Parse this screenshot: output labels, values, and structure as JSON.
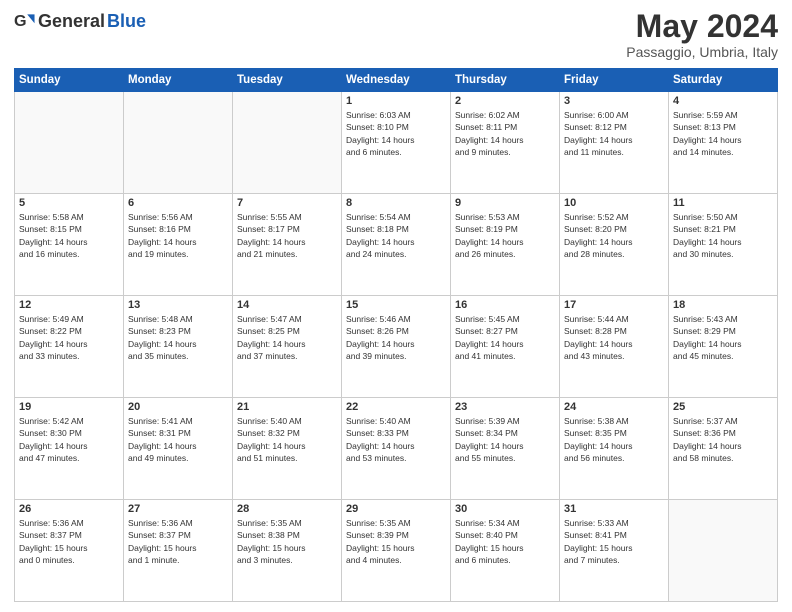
{
  "header": {
    "logo_general": "General",
    "logo_blue": "Blue",
    "title": "May 2024",
    "location": "Passaggio, Umbria, Italy"
  },
  "days_of_week": [
    "Sunday",
    "Monday",
    "Tuesday",
    "Wednesday",
    "Thursday",
    "Friday",
    "Saturday"
  ],
  "weeks": [
    [
      {
        "day": "",
        "info": ""
      },
      {
        "day": "",
        "info": ""
      },
      {
        "day": "",
        "info": ""
      },
      {
        "day": "1",
        "info": "Sunrise: 6:03 AM\nSunset: 8:10 PM\nDaylight: 14 hours\nand 6 minutes."
      },
      {
        "day": "2",
        "info": "Sunrise: 6:02 AM\nSunset: 8:11 PM\nDaylight: 14 hours\nand 9 minutes."
      },
      {
        "day": "3",
        "info": "Sunrise: 6:00 AM\nSunset: 8:12 PM\nDaylight: 14 hours\nand 11 minutes."
      },
      {
        "day": "4",
        "info": "Sunrise: 5:59 AM\nSunset: 8:13 PM\nDaylight: 14 hours\nand 14 minutes."
      }
    ],
    [
      {
        "day": "5",
        "info": "Sunrise: 5:58 AM\nSunset: 8:15 PM\nDaylight: 14 hours\nand 16 minutes."
      },
      {
        "day": "6",
        "info": "Sunrise: 5:56 AM\nSunset: 8:16 PM\nDaylight: 14 hours\nand 19 minutes."
      },
      {
        "day": "7",
        "info": "Sunrise: 5:55 AM\nSunset: 8:17 PM\nDaylight: 14 hours\nand 21 minutes."
      },
      {
        "day": "8",
        "info": "Sunrise: 5:54 AM\nSunset: 8:18 PM\nDaylight: 14 hours\nand 24 minutes."
      },
      {
        "day": "9",
        "info": "Sunrise: 5:53 AM\nSunset: 8:19 PM\nDaylight: 14 hours\nand 26 minutes."
      },
      {
        "day": "10",
        "info": "Sunrise: 5:52 AM\nSunset: 8:20 PM\nDaylight: 14 hours\nand 28 minutes."
      },
      {
        "day": "11",
        "info": "Sunrise: 5:50 AM\nSunset: 8:21 PM\nDaylight: 14 hours\nand 30 minutes."
      }
    ],
    [
      {
        "day": "12",
        "info": "Sunrise: 5:49 AM\nSunset: 8:22 PM\nDaylight: 14 hours\nand 33 minutes."
      },
      {
        "day": "13",
        "info": "Sunrise: 5:48 AM\nSunset: 8:23 PM\nDaylight: 14 hours\nand 35 minutes."
      },
      {
        "day": "14",
        "info": "Sunrise: 5:47 AM\nSunset: 8:25 PM\nDaylight: 14 hours\nand 37 minutes."
      },
      {
        "day": "15",
        "info": "Sunrise: 5:46 AM\nSunset: 8:26 PM\nDaylight: 14 hours\nand 39 minutes."
      },
      {
        "day": "16",
        "info": "Sunrise: 5:45 AM\nSunset: 8:27 PM\nDaylight: 14 hours\nand 41 minutes."
      },
      {
        "day": "17",
        "info": "Sunrise: 5:44 AM\nSunset: 8:28 PM\nDaylight: 14 hours\nand 43 minutes."
      },
      {
        "day": "18",
        "info": "Sunrise: 5:43 AM\nSunset: 8:29 PM\nDaylight: 14 hours\nand 45 minutes."
      }
    ],
    [
      {
        "day": "19",
        "info": "Sunrise: 5:42 AM\nSunset: 8:30 PM\nDaylight: 14 hours\nand 47 minutes."
      },
      {
        "day": "20",
        "info": "Sunrise: 5:41 AM\nSunset: 8:31 PM\nDaylight: 14 hours\nand 49 minutes."
      },
      {
        "day": "21",
        "info": "Sunrise: 5:40 AM\nSunset: 8:32 PM\nDaylight: 14 hours\nand 51 minutes."
      },
      {
        "day": "22",
        "info": "Sunrise: 5:40 AM\nSunset: 8:33 PM\nDaylight: 14 hours\nand 53 minutes."
      },
      {
        "day": "23",
        "info": "Sunrise: 5:39 AM\nSunset: 8:34 PM\nDaylight: 14 hours\nand 55 minutes."
      },
      {
        "day": "24",
        "info": "Sunrise: 5:38 AM\nSunset: 8:35 PM\nDaylight: 14 hours\nand 56 minutes."
      },
      {
        "day": "25",
        "info": "Sunrise: 5:37 AM\nSunset: 8:36 PM\nDaylight: 14 hours\nand 58 minutes."
      }
    ],
    [
      {
        "day": "26",
        "info": "Sunrise: 5:36 AM\nSunset: 8:37 PM\nDaylight: 15 hours\nand 0 minutes."
      },
      {
        "day": "27",
        "info": "Sunrise: 5:36 AM\nSunset: 8:37 PM\nDaylight: 15 hours\nand 1 minute."
      },
      {
        "day": "28",
        "info": "Sunrise: 5:35 AM\nSunset: 8:38 PM\nDaylight: 15 hours\nand 3 minutes."
      },
      {
        "day": "29",
        "info": "Sunrise: 5:35 AM\nSunset: 8:39 PM\nDaylight: 15 hours\nand 4 minutes."
      },
      {
        "day": "30",
        "info": "Sunrise: 5:34 AM\nSunset: 8:40 PM\nDaylight: 15 hours\nand 6 minutes."
      },
      {
        "day": "31",
        "info": "Sunrise: 5:33 AM\nSunset: 8:41 PM\nDaylight: 15 hours\nand 7 minutes."
      },
      {
        "day": "",
        "info": ""
      }
    ]
  ]
}
